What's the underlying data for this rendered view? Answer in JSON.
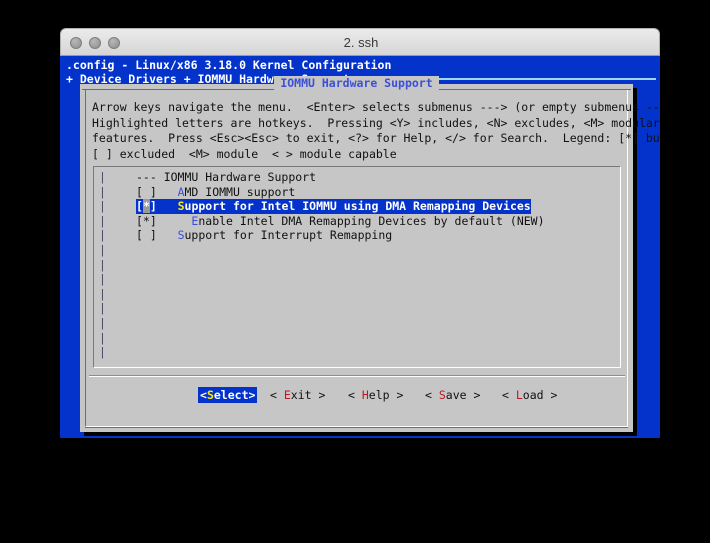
{
  "window": {
    "title": "2. ssh",
    "traffic_lights": [
      "close-button",
      "minimize-button",
      "zoom-button"
    ]
  },
  "terminal": {
    "background_color": "#0433CC",
    "header_line_1": ".config - Linux/x86 3.18.0 Kernel Configuration",
    "header_line_2": "+ Device Drivers + IOMMU Hardware Support"
  },
  "dialog": {
    "title": "IOMMU Hardware Support",
    "title_color": "#3b4fd8",
    "background_color": "#c6c6c6",
    "help_lines": [
      "Arrow keys navigate the menu.  <Enter> selects submenus ---> (or empty submenus ----).",
      "Highlighted letters are hotkeys.  Pressing <Y> includes, <N> excludes, <M> modularizes",
      "features.  Press <Esc><Esc> to exit, <?> for Help, </> for Search.  Legend: [*] built-in",
      "[ ] excluded  <M> module  < > module capable"
    ],
    "menu": {
      "gutter_char": "|",
      "rows": [
        {
          "marker": "",
          "prefix": "--- ",
          "hotkey": "",
          "text": "IOMMU Hardware Support",
          "selected": false,
          "indent": 0
        },
        {
          "marker": "[ ]",
          "prefix": "",
          "hotkey": "A",
          "text": "MD IOMMU support",
          "selected": false,
          "indent": 0
        },
        {
          "marker": "[*]",
          "prefix": "",
          "hotkey": "S",
          "text": "upport for Intel IOMMU using DMA Remapping Devices",
          "selected": true,
          "indent": 0
        },
        {
          "marker": "[*]",
          "prefix": "",
          "hotkey": "E",
          "text": "nable Intel DMA Remapping Devices by default (NEW)",
          "selected": false,
          "indent": 1
        },
        {
          "marker": "[ ]",
          "prefix": "",
          "hotkey": "S",
          "text": "upport for Interrupt Remapping",
          "selected": false,
          "indent": 0
        }
      ]
    },
    "buttons": [
      {
        "label": "<Select>",
        "hotkey": "S",
        "before": "<",
        "after": "elect>",
        "selected": true
      },
      {
        "label": "< Exit >",
        "hotkey": "E",
        "before": "< ",
        "after": "xit >",
        "selected": false
      },
      {
        "label": "< Help >",
        "hotkey": "H",
        "before": "< ",
        "after": "elp >",
        "selected": false
      },
      {
        "label": "< Save >",
        "hotkey": "S",
        "before": "< ",
        "after": "ave >",
        "selected": false
      },
      {
        "label": "< Load >",
        "hotkey": "L",
        "before": "< ",
        "after": "oad >",
        "selected": false
      }
    ],
    "selected_highlight_color": "#0433CC",
    "hotkey_color": "#c01722"
  }
}
